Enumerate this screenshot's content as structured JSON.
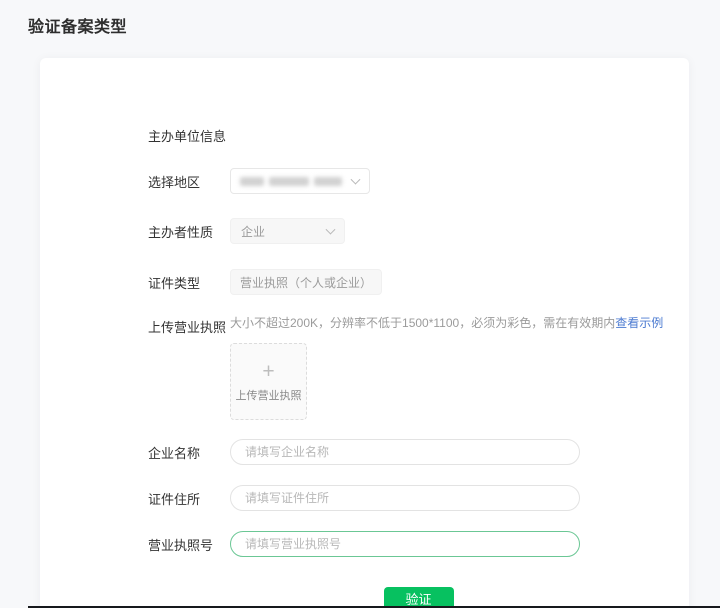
{
  "page": {
    "title": "验证备案类型"
  },
  "colors": {
    "accent_green": "#07c160",
    "focus_border_green": "#6bc795",
    "link_blue": "#4c7bd1",
    "page_background": "#f7f8fa",
    "card_background": "#ffffff"
  },
  "form": {
    "section_title": "主办单位信息",
    "region": {
      "label": "选择地区",
      "value_redacted": true
    },
    "nature": {
      "label": "主办者性质",
      "value": "企业"
    },
    "cert_type": {
      "label": "证件类型",
      "value": "营业执照（个人或企业）"
    },
    "upload": {
      "label": "上传营业执照",
      "hint": "大小不超过200K，分辨率不低于1500*1100，必须为彩色，需在有效期内",
      "example_link": "查看示例",
      "plus_icon": "+",
      "box_label": "上传营业执照"
    },
    "company_name": {
      "label": "企业名称",
      "placeholder": "请填写企业名称"
    },
    "cert_address": {
      "label": "证件住所",
      "placeholder": "请填写证件住所"
    },
    "license_no": {
      "label": "营业执照号",
      "placeholder": "请填写营业执照号"
    },
    "submit_label": "验证"
  }
}
